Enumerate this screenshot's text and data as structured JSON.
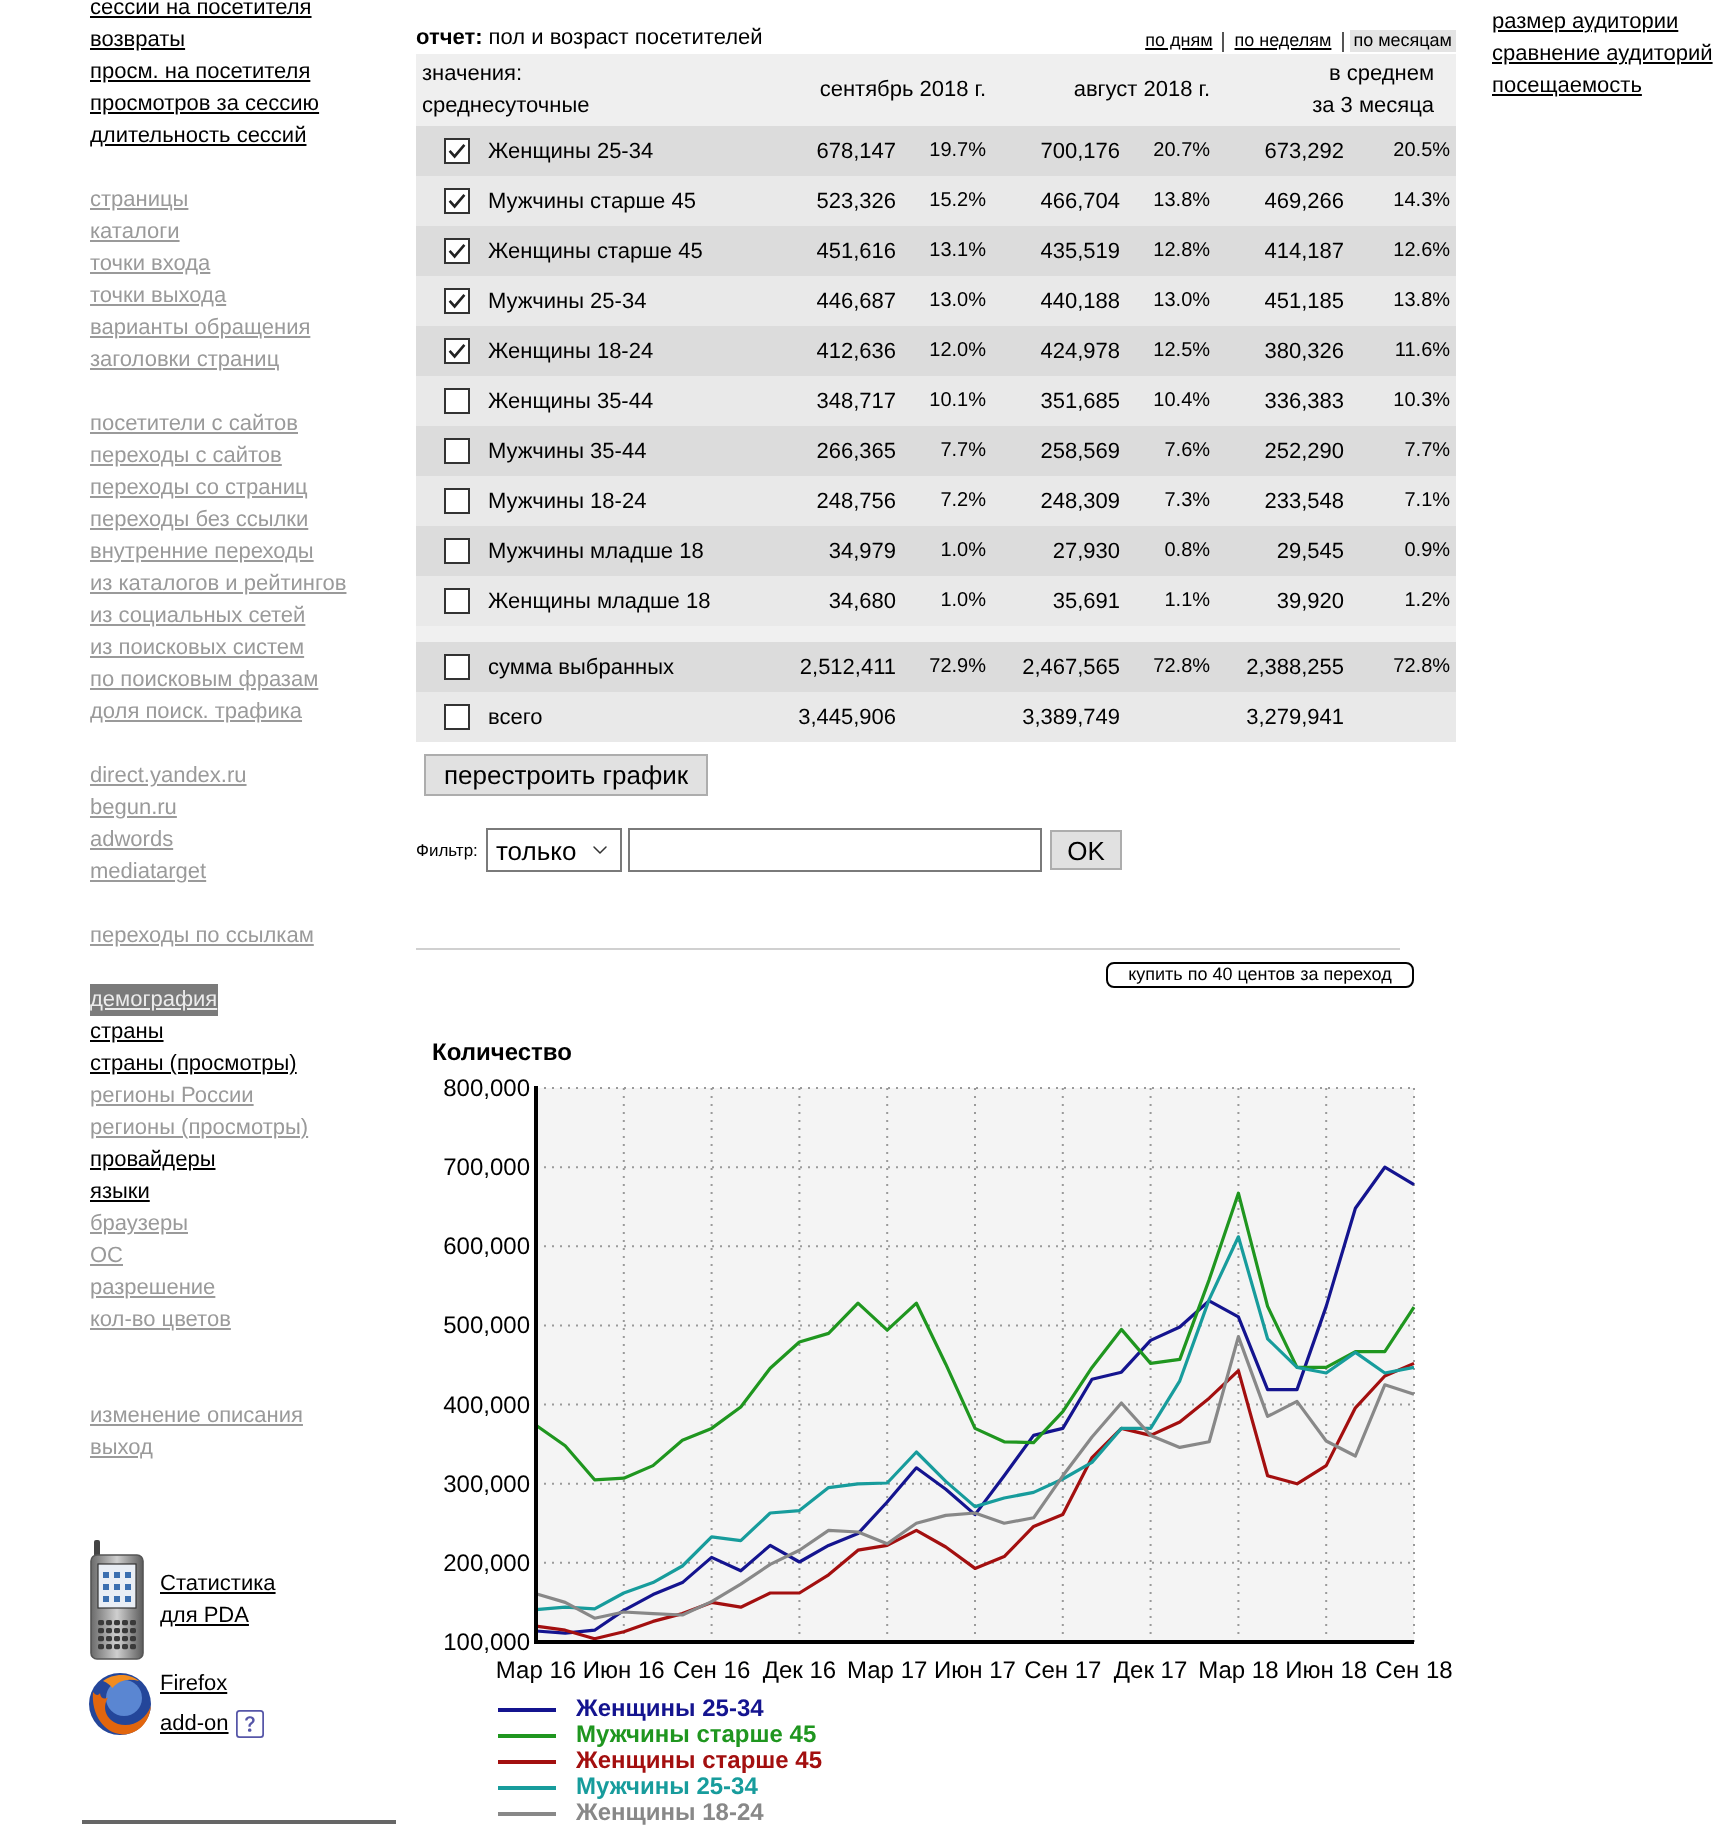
{
  "sidebar": {
    "groups": [
      {
        "items": [
          {
            "label": "сессии на посетителя",
            "available": true,
            "selected": false
          },
          {
            "label": "возвраты",
            "available": true,
            "selected": false
          },
          {
            "label": "просм. на посетителя",
            "available": true,
            "selected": false
          },
          {
            "label": "просмотров за сессию",
            "available": true,
            "selected": false
          },
          {
            "label": "длительность сессий",
            "available": true,
            "selected": false
          }
        ]
      },
      {
        "items": [
          {
            "label": "страницы",
            "available": false,
            "selected": false
          },
          {
            "label": "каталоги",
            "available": false,
            "selected": false
          },
          {
            "label": "точки входа",
            "available": false,
            "selected": false
          },
          {
            "label": "точки выхода",
            "available": false,
            "selected": false
          },
          {
            "label": "варианты обращения",
            "available": false,
            "selected": false
          },
          {
            "label": "заголовки страниц",
            "available": false,
            "selected": false
          }
        ]
      },
      {
        "items": [
          {
            "label": "посетители с сайтов",
            "available": false,
            "selected": false
          },
          {
            "label": "переходы с сайтов",
            "available": false,
            "selected": false
          },
          {
            "label": "переходы со страниц",
            "available": false,
            "selected": false
          },
          {
            "label": "переходы без ссылки",
            "available": false,
            "selected": false
          },
          {
            "label": "внутренние переходы",
            "available": false,
            "selected": false
          },
          {
            "label": "из каталогов и рейтингов",
            "available": false,
            "selected": false
          },
          {
            "label": "из социальных сетей",
            "available": false,
            "selected": false
          },
          {
            "label": "из поисковых систем",
            "available": false,
            "selected": false
          },
          {
            "label": "по поисковым фразам",
            "available": false,
            "selected": false
          },
          {
            "label": "доля поиск. трафика",
            "available": false,
            "selected": false
          }
        ]
      },
      {
        "items": [
          {
            "label": "direct.yandex.ru",
            "available": false,
            "selected": false
          },
          {
            "label": "begun.ru",
            "available": false,
            "selected": false
          },
          {
            "label": "adwords",
            "available": false,
            "selected": false
          },
          {
            "label": "mediatarget",
            "available": false,
            "selected": false
          }
        ]
      },
      {
        "items": [
          {
            "label": "переходы по ссылкам",
            "available": false,
            "selected": false
          }
        ]
      },
      {
        "items": [
          {
            "label": "демография",
            "available": true,
            "selected": true
          },
          {
            "label": "страны",
            "available": true,
            "selected": false
          },
          {
            "label": "страны (просмотры)",
            "available": true,
            "selected": false
          },
          {
            "label": "регионы России",
            "available": false,
            "selected": false
          },
          {
            "label": "регионы (просмотры)",
            "available": false,
            "selected": false
          },
          {
            "label": "провайдеры",
            "available": true,
            "selected": false
          },
          {
            "label": "языки",
            "available": true,
            "selected": false
          },
          {
            "label": "браузеры",
            "available": false,
            "selected": false
          },
          {
            "label": "ОС",
            "available": false,
            "selected": false
          },
          {
            "label": "разрешение",
            "available": false,
            "selected": false
          },
          {
            "label": "кол-во цветов",
            "available": false,
            "selected": false
          }
        ]
      }
    ],
    "account_links": [
      {
        "label": "изменение описания",
        "available": false
      },
      {
        "label": "выход",
        "available": false
      }
    ],
    "promos": [
      {
        "kind": "pda",
        "label": "Статистика для PDA"
      },
      {
        "kind": "firefox",
        "label": "Firefox add-on",
        "help": true
      }
    ]
  },
  "report": {
    "title": "**отчет:** пол и возраст посетителей",
    "periods": [
      {
        "label": "по дням",
        "selected": false
      },
      {
        "label": "по неделям",
        "selected": false
      },
      {
        "label": "по месяцам",
        "selected": true
      }
    ]
  },
  "table": {
    "values_label": "значения:",
    "values_mode": "среднесуточные",
    "columns": [
      "сентябрь 2018 г.",
      "август 2018 г.",
      "в среднем за 3 месяца"
    ],
    "rows": [
      {
        "label": "Женщины 25-34",
        "checked": true,
        "periods": [
          {
            "count": "678,147",
            "share": "19.7%"
          },
          {
            "count": "700,176",
            "share": "20.7%"
          },
          {
            "count": "673,292",
            "share": "20.5%"
          }
        ]
      },
      {
        "label": "Мужчины старше 45",
        "checked": true,
        "periods": [
          {
            "count": "523,326",
            "share": "15.2%"
          },
          {
            "count": "466,704",
            "share": "13.8%"
          },
          {
            "count": "469,266",
            "share": "14.3%"
          }
        ]
      },
      {
        "label": "Женщины старше 45",
        "checked": true,
        "periods": [
          {
            "count": "451,616",
            "share": "13.1%"
          },
          {
            "count": "435,519",
            "share": "12.8%"
          },
          {
            "count": "414,187",
            "share": "12.6%"
          }
        ]
      },
      {
        "label": "Мужчины 25-34",
        "checked": true,
        "periods": [
          {
            "count": "446,687",
            "share": "13.0%"
          },
          {
            "count": "440,188",
            "share": "13.0%"
          },
          {
            "count": "451,185",
            "share": "13.8%"
          }
        ]
      },
      {
        "label": "Женщины 18-24",
        "checked": true,
        "periods": [
          {
            "count": "412,636",
            "share": "12.0%"
          },
          {
            "count": "424,978",
            "share": "12.5%"
          },
          {
            "count": "380,326",
            "share": "11.6%"
          }
        ]
      },
      {
        "label": "Женщины 35-44",
        "checked": false,
        "periods": [
          {
            "count": "348,717",
            "share": "10.1%"
          },
          {
            "count": "351,685",
            "share": "10.4%"
          },
          {
            "count": "336,383",
            "share": "10.3%"
          }
        ]
      },
      {
        "label": "Мужчины 35-44",
        "checked": false,
        "periods": [
          {
            "count": "266,365",
            "share": "7.7%"
          },
          {
            "count": "258,569",
            "share": "7.6%"
          },
          {
            "count": "252,290",
            "share": "7.7%"
          }
        ]
      },
      {
        "label": "Мужчины 18-24",
        "checked": false,
        "periods": [
          {
            "count": "248,756",
            "share": "7.2%"
          },
          {
            "count": "248,309",
            "share": "7.3%"
          },
          {
            "count": "233,548",
            "share": "7.1%"
          }
        ]
      },
      {
        "label": "Мужчины младше 18",
        "checked": false,
        "periods": [
          {
            "count": "34,979",
            "share": "1.0%"
          },
          {
            "count": "27,930",
            "share": "0.8%"
          },
          {
            "count": "29,545",
            "share": "0.9%"
          }
        ]
      },
      {
        "label": "Женщины младше 18",
        "checked": false,
        "periods": [
          {
            "count": "34,680",
            "share": "1.0%"
          },
          {
            "count": "35,691",
            "share": "1.1%"
          },
          {
            "count": "39,920",
            "share": "1.2%"
          }
        ]
      }
    ],
    "summary_rows": [
      {
        "label": "сумма выбранных",
        "checked": false,
        "periods": [
          {
            "count": "2,512,411",
            "share": "72.9%"
          },
          {
            "count": "2,467,565",
            "share": "72.8%"
          },
          {
            "count": "2,388,255",
            "share": "72.8%"
          }
        ]
      },
      {
        "label": "всего",
        "checked": false,
        "periods": [
          {
            "count": "3,445,906"
          },
          {
            "count": "3,389,749"
          },
          {
            "count": "3,279,941"
          }
        ]
      }
    ]
  },
  "rebuild_button": "перестроить график",
  "filter": {
    "label": "Фильтр:",
    "mode": "только",
    "button": "OK"
  },
  "buy_button": "купить по 40 центов за переход",
  "chart": {
    "chart_data": {
      "type": "line",
      "title": "Количество",
      "categories": [
        "Мар 16",
        null,
        null,
        "Июн 16",
        null,
        null,
        "Сен 16",
        null,
        null,
        "Дек 16",
        null,
        null,
        "Мар 17",
        null,
        null,
        "Июн 17",
        null,
        null,
        "Сен 17",
        null,
        null,
        "Дек 17",
        null,
        null,
        "Мар 18",
        null,
        null,
        "Июн 18",
        null,
        null,
        "Сен 18"
      ],
      "ylim": [
        100000,
        800000
      ],
      "yticks": [
        {
          "value": 100000,
          "label": "100,000"
        },
        {
          "value": 200000,
          "label": "200,000"
        },
        {
          "value": 300000,
          "label": "300,000"
        },
        {
          "value": 400000,
          "label": "400,000"
        },
        {
          "value": 500000,
          "label": "500,000"
        },
        {
          "value": 600000,
          "label": "600,000"
        },
        {
          "value": 700000,
          "label": "700,000"
        },
        {
          "value": 800000,
          "label": "800,000"
        }
      ],
      "grid": true,
      "legend": "bottom",
      "series": [
        {
          "name": "Женщины 25-34",
          "color": "#14148f",
          "values": [
            114000,
            111000,
            115000,
            140000,
            160000,
            175000,
            207000,
            190000,
            222000,
            201000,
            222000,
            237000,
            277000,
            320000,
            293000,
            261000,
            310000,
            361000,
            370000,
            432000,
            441000,
            481000,
            498000,
            531000,
            511000,
            419000,
            419000,
            524000,
            648000,
            700000,
            678000
          ]
        },
        {
          "name": "Мужчины старше 45",
          "color": "#1f961f",
          "values": [
            374000,
            348000,
            305000,
            307000,
            323000,
            355000,
            370000,
            397000,
            446000,
            479000,
            490000,
            528000,
            494000,
            528000,
            451000,
            370000,
            353000,
            352000,
            391000,
            447000,
            495000,
            452000,
            457000,
            558000,
            667000,
            524000,
            447000,
            447000,
            467000,
            467000,
            523000
          ]
        },
        {
          "name": "Женщины старше 45",
          "color": "#a30f0f",
          "values": [
            120000,
            115000,
            104000,
            113000,
            126000,
            136000,
            150000,
            144000,
            162000,
            162000,
            185000,
            216000,
            222000,
            241000,
            220000,
            193000,
            208000,
            246000,
            261000,
            333000,
            370000,
            361000,
            378000,
            408000,
            443000,
            310000,
            300000,
            323000,
            396000,
            436000,
            452000
          ]
        },
        {
          "name": "Мужчины 25-34",
          "color": "#179c9c",
          "values": [
            141000,
            144000,
            142000,
            162000,
            175000,
            196000,
            233000,
            228000,
            263000,
            266000,
            295000,
            300000,
            301000,
            340000,
            303000,
            271000,
            282000,
            289000,
            306000,
            327000,
            370000,
            370000,
            430000,
            533000,
            612000,
            483000,
            447000,
            440000,
            466000,
            440000,
            447000
          ]
        },
        {
          "name": "Женщины 18-24",
          "color": "#888888",
          "values": [
            161000,
            150000,
            130000,
            138000,
            136000,
            134000,
            151000,
            173000,
            198000,
            216000,
            241000,
            239000,
            224000,
            250000,
            260000,
            263000,
            250000,
            257000,
            310000,
            359000,
            402000,
            361000,
            346000,
            353000,
            486000,
            385000,
            404000,
            354000,
            335000,
            425000,
            413000
          ]
        }
      ]
    }
  },
  "right_links": [
    "размер аудитории",
    "сравнение аудиторий",
    "посещаемость"
  ]
}
